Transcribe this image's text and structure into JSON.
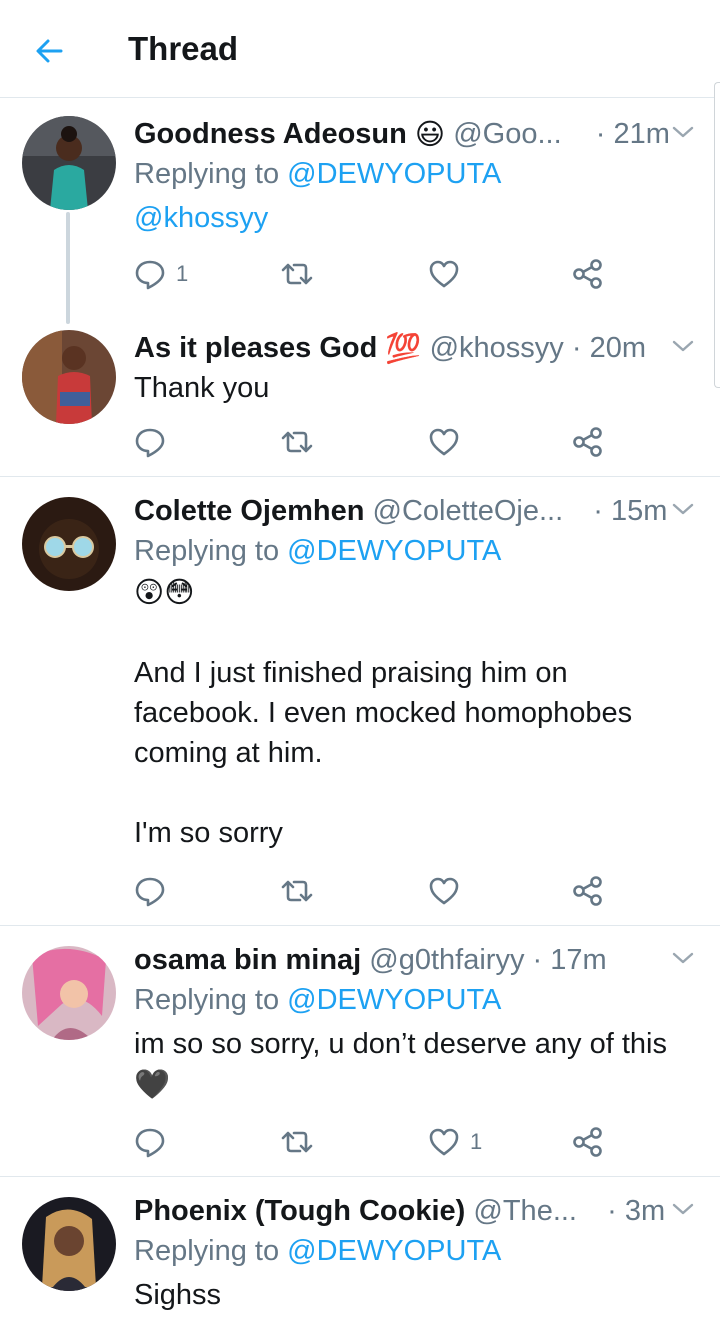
{
  "header": {
    "title": "Thread"
  },
  "tweets": [
    {
      "name": "Goodness Adeosun",
      "name_emoji": "😃",
      "handle": "@Goo...",
      "dot": "·",
      "time": "21m",
      "reply_prefix": "Replying to",
      "reply_to": "@DEWYOPUTA",
      "body": "@khossyy",
      "reply_count": "1",
      "like_count": "",
      "avatar_colors": [
        "#3b3d42",
        "#2aa9a0"
      ]
    },
    {
      "name": "As it pleases God",
      "name_emoji": "💯",
      "handle": "@khossyy",
      "dot": "·",
      "time": "20m",
      "body": "Thank you",
      "reply_count": "",
      "like_count": "",
      "avatar_colors": [
        "#7a3a2a",
        "#c83a3a"
      ]
    },
    {
      "name": "Colette Ojemhen",
      "handle": "@ColetteOje...",
      "dot": "·",
      "time": "15m",
      "reply_prefix": "Replying to",
      "reply_to": "@DEWYOPUTA",
      "body_emojis": "😲😳",
      "body_p1": "And I just finished praising him on facebook. I even mocked homophobes coming at him.",
      "body_p2": "I'm so sorry",
      "reply_count": "",
      "like_count": "",
      "avatar_colors": [
        "#3a2416",
        "#9fd8e8"
      ]
    },
    {
      "name": "osama bin minaj",
      "handle": "@g0thfairyy",
      "dot": "·",
      "time": "17m",
      "reply_prefix": "Replying to",
      "reply_to": "@DEWYOPUTA",
      "body": "im so so sorry, u don’t deserve any of this",
      "body_emoji": "🖤",
      "reply_count": "",
      "like_count": "1",
      "avatar_colors": [
        "#e56fa3",
        "#f2c3a8"
      ]
    },
    {
      "name": "Phoenix (Tough Cookie)",
      "handle": "@The...",
      "dot": "·",
      "time": "3m",
      "reply_prefix": "Replying to",
      "reply_to": "@DEWYOPUTA",
      "body": "Sighss",
      "avatar_colors": [
        "#1a1a22",
        "#c99a5a"
      ]
    }
  ],
  "colors": {
    "accent": "#1da1f2",
    "text": "#14171a",
    "muted": "#657786",
    "divider": "#e1e8ed"
  },
  "icons": [
    "back-arrow-icon",
    "reply-icon",
    "retweet-icon",
    "like-icon",
    "share-icon",
    "caret-down-icon"
  ]
}
